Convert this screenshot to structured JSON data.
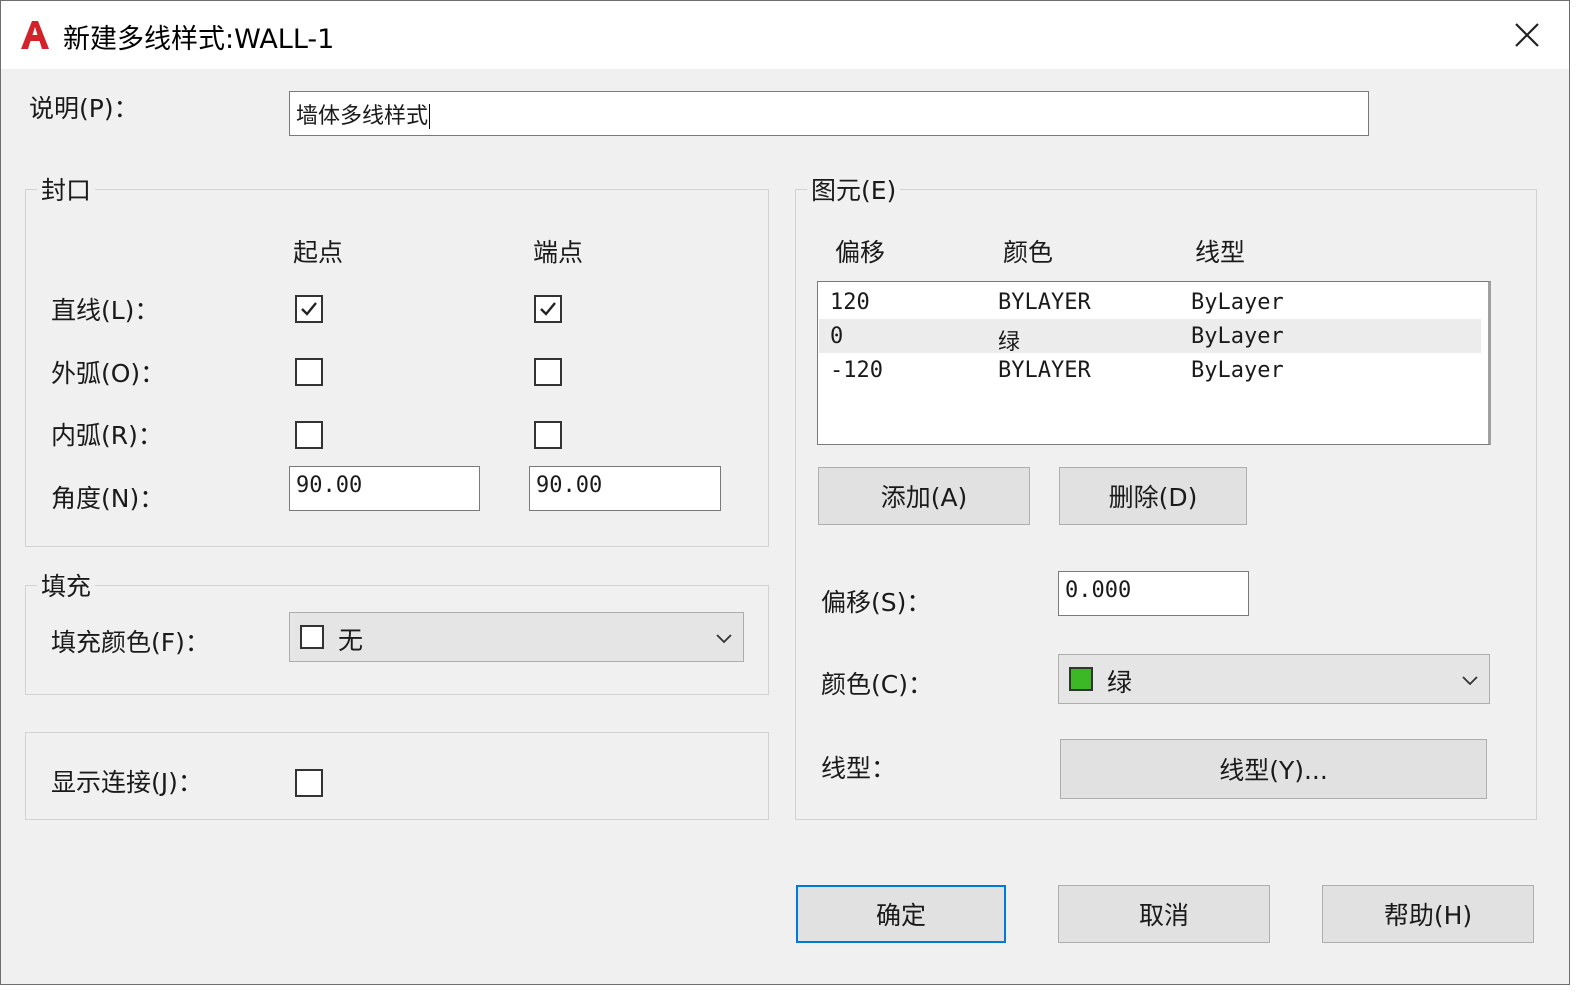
{
  "window": {
    "title": "新建多线样式:WALL-1"
  },
  "description": {
    "label": "说明(P)：",
    "value": "墙体多线样式"
  },
  "caps": {
    "title": "封口",
    "start_header": "起点",
    "end_header": "端点",
    "line": {
      "label": "直线(L)：",
      "start": true,
      "end": true
    },
    "outer_arc": {
      "label": "外弧(O)：",
      "start": false,
      "end": false
    },
    "inner_arc": {
      "label": "内弧(R)：",
      "start": false,
      "end": false
    },
    "angle": {
      "label": "角度(N)：",
      "start": "90.00",
      "end": "90.00"
    }
  },
  "fill": {
    "title": "填充",
    "label": "填充颜色(F)：",
    "value": "无",
    "swatch": "#ffffff"
  },
  "joints": {
    "label": "显示连接(J)：",
    "checked": false
  },
  "elements": {
    "title": "图元(E)",
    "headers": [
      "偏移",
      "颜色",
      "线型"
    ],
    "rows": [
      {
        "offset": "120",
        "color": "BYLAYER",
        "linetype": "ByLayer"
      },
      {
        "offset": "0",
        "color": "绿",
        "linetype": "ByLayer"
      },
      {
        "offset": "-120",
        "color": "BYLAYER",
        "linetype": "ByLayer"
      }
    ],
    "selected_index": 1,
    "add_button": "添加(A)",
    "delete_button": "删除(D)",
    "offset_label": "偏移(S)：",
    "offset_value": "0.000",
    "color_label": "颜色(C)：",
    "color_value": "绿",
    "color_swatch": "#3cb827",
    "linetype_label": "线型：",
    "linetype_button": "线型(Y)..."
  },
  "buttons": {
    "ok": "确定",
    "cancel": "取消",
    "help": "帮助(H)"
  }
}
